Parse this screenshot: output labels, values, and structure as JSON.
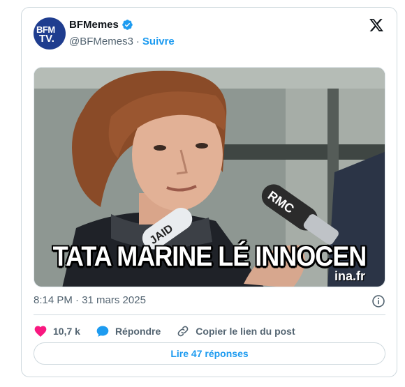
{
  "author": {
    "display_name": "BFMemes",
    "handle": "@BFMemes3",
    "follow_label": "Suivre",
    "avatar_line1": "BFM",
    "avatar_line2": "TV."
  },
  "media": {
    "caption": "TATA MARINE LÉ INNOCEN",
    "watermark": "ina.fr",
    "mic_label_1": "RMC",
    "mic_label_2": "JAID"
  },
  "post": {
    "timestamp": "8:14 PM · 31 mars 2025"
  },
  "actions": {
    "likes": "10,7 k",
    "reply_label": "Répondre",
    "copy_link_label": "Copier le lien du post",
    "read_replies_label": "Lire 47 réponses"
  },
  "colors": {
    "accent": "#1d9bf0",
    "like": "#f91880",
    "avatar_bg": "#1f3d8f"
  }
}
